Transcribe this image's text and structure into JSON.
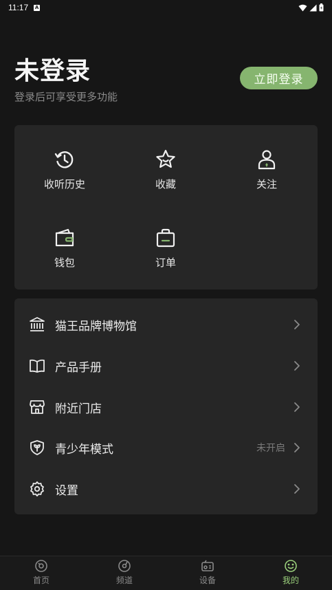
{
  "status_bar": {
    "time": "11:17",
    "notification_glyph": "A"
  },
  "header": {
    "title": "未登录",
    "subtitle": "登录后可享受更多功能",
    "login_button": "立即登录"
  },
  "quick_actions": [
    {
      "label": "收听历史",
      "icon": "history-icon"
    },
    {
      "label": "收藏",
      "icon": "star-icon"
    },
    {
      "label": "关注",
      "icon": "person-icon"
    },
    {
      "label": "钱包",
      "icon": "wallet-icon"
    },
    {
      "label": "订单",
      "icon": "bag-icon"
    }
  ],
  "menu": [
    {
      "label": "猫王品牌博物馆",
      "value": "",
      "icon": "museum-icon"
    },
    {
      "label": "产品手册",
      "value": "",
      "icon": "book-icon"
    },
    {
      "label": "附近门店",
      "value": "",
      "icon": "store-icon"
    },
    {
      "label": "青少年模式",
      "value": "未开启",
      "icon": "shield-sprout-icon"
    },
    {
      "label": "设置",
      "value": "",
      "icon": "gear-icon"
    }
  ],
  "bottom_nav": [
    {
      "label": "首页",
      "icon": "home-disc-icon",
      "active": false
    },
    {
      "label": "频道",
      "icon": "channel-disc-icon",
      "active": false
    },
    {
      "label": "设备",
      "icon": "radio-icon",
      "active": false
    },
    {
      "label": "我的",
      "icon": "smile-icon",
      "active": true
    }
  ],
  "colors": {
    "accent": "#86b56f",
    "active_nav": "#9bd07c",
    "background": "#161616",
    "card": "#262626"
  }
}
